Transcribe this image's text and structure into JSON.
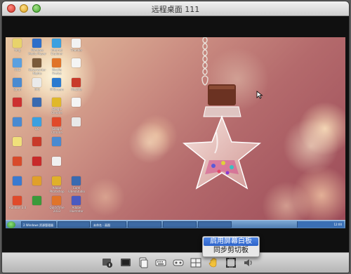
{
  "window": {
    "title": "远程桌面  111"
  },
  "desktop": {
    "icons": [
      {
        "label": "fang",
        "color": "#e8d36a"
      },
      {
        "label": "Windows Media Player",
        "color": "#2d6ec9"
      },
      {
        "label": "Internet Explorer",
        "color": "#3aa0e0"
      },
      {
        "label": "Thunder",
        "color": "#f2f2f2"
      },
      {
        "label": "HNS",
        "color": "#5aa0e0"
      },
      {
        "label": "Neverwinter Nights",
        "color": "#7a5a3a"
      },
      {
        "label": "Mozilla Firefox",
        "color": "#e0742a"
      },
      {
        "label": "",
        "color": "#f4f4f4"
      },
      {
        "label": "Safari",
        "color": "#4a8ad0"
      },
      {
        "label": "PPS",
        "color": "#eaeaea"
      },
      {
        "label": "PPStream",
        "color": "#2a7ad0"
      },
      {
        "label": "FileZilla",
        "color": "#c83a2a"
      },
      {
        "label": "",
        "color": "#cc3030"
      },
      {
        "label": "",
        "color": "#3a6ab0"
      },
      {
        "label": "Google Chrome",
        "color": "#e0b82a"
      },
      {
        "label": "",
        "color": "#f4f4f4"
      },
      {
        "label": "",
        "color": "#4a8ad0"
      },
      {
        "label": "QQ",
        "color": "#3aa0e0"
      },
      {
        "label": "Google Chrome",
        "color": "#e04a2a"
      },
      {
        "label": "",
        "color": "#e8e8e8"
      },
      {
        "label": "",
        "color": "#f0e07a"
      },
      {
        "label": "",
        "color": "#c83a2a"
      },
      {
        "label": "",
        "color": "#4a8ad0"
      },
      {
        "label": "",
        "color": "#d84a2a"
      },
      {
        "label": "",
        "color": "#c82a2a"
      },
      {
        "label": "",
        "color": "#f0f0f0"
      },
      {
        "label": "",
        "color": "#3a7ad0"
      },
      {
        "label": "",
        "color": "#e0a02a"
      },
      {
        "label": "Adobe Photoshop CS4",
        "color": "#e0b02a"
      },
      {
        "label": "Audition 3.0",
        "color": "#e04a2a"
      },
      {
        "label": "",
        "color": "#3a9a3a"
      },
      {
        "label": "QuickTime 2013",
        "color": "#e0742a"
      },
      {
        "label": "Corel VideoStudio",
        "color": "#3a6ab0"
      },
      {
        "label": "Adobe Illustrator",
        "color": "#4a5ac0"
      }
    ]
  },
  "taskbar": {
    "tasks": [
      {
        "label": "2 Windows 资源管理器"
      },
      {
        "label": ""
      },
      {
        "label": "未命名 - 画图"
      },
      {
        "label": ""
      },
      {
        "label": ""
      },
      {
        "label": ""
      }
    ],
    "clock": "12:00"
  },
  "context_menu": {
    "items": [
      "启用屏幕白板",
      "同步剪切板"
    ]
  },
  "toolbar": {
    "buttons": [
      {
        "name": "info-icon"
      },
      {
        "name": "screen-icon"
      },
      {
        "name": "copy-icon"
      },
      {
        "name": "keyboard-icon"
      },
      {
        "name": "controller-icon"
      },
      {
        "name": "grid-icon"
      },
      {
        "name": "hand-icon"
      },
      {
        "name": "fullscreen-icon"
      },
      {
        "name": "speaker-icon"
      }
    ]
  }
}
